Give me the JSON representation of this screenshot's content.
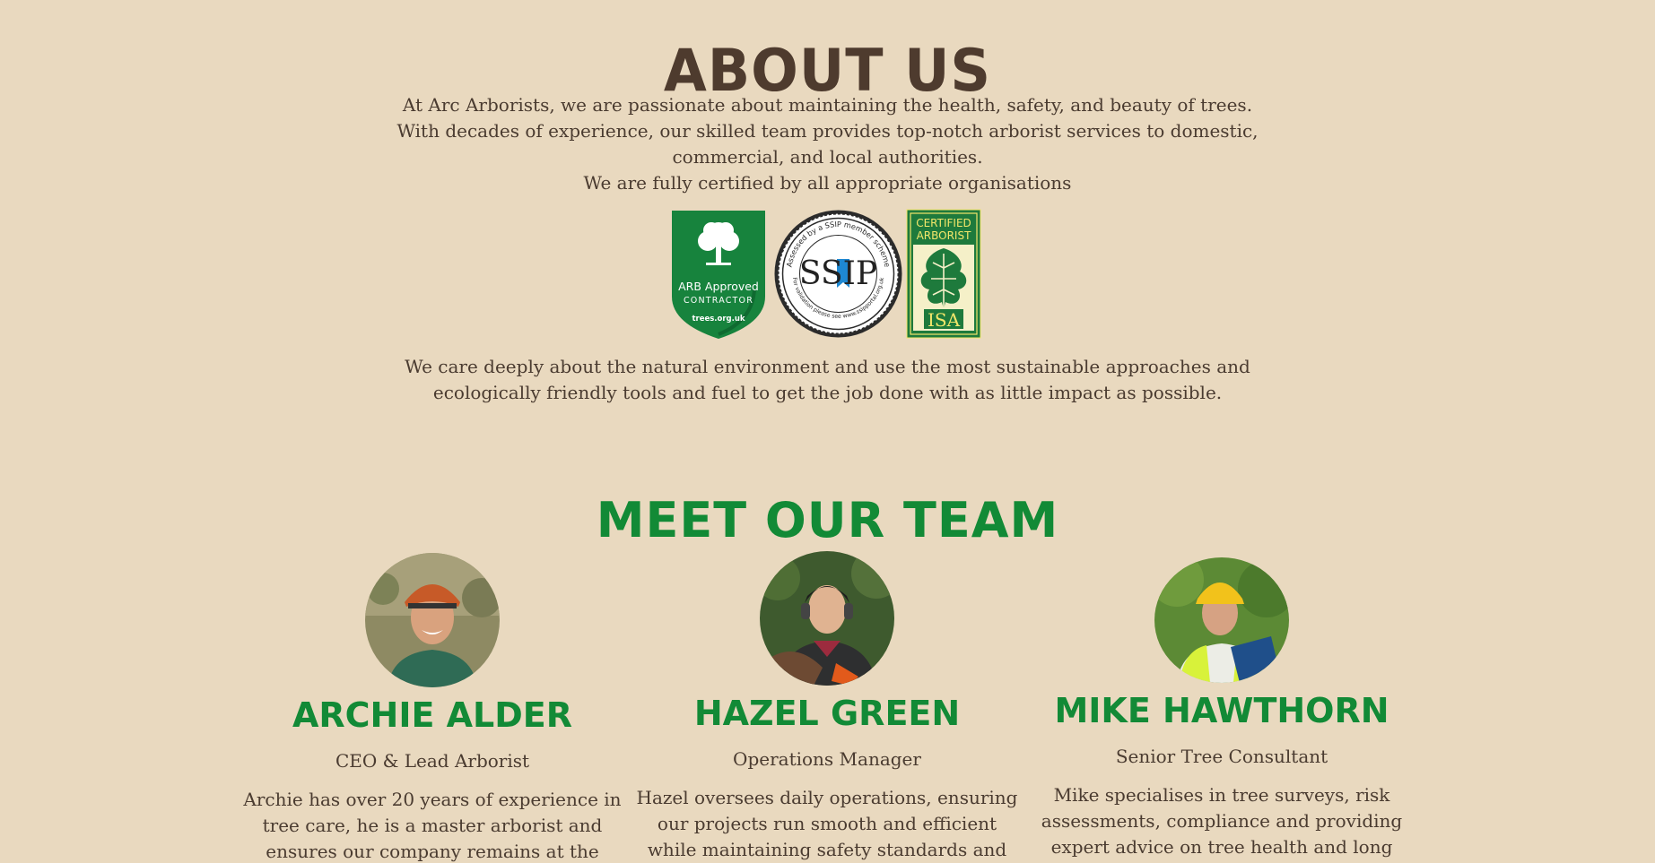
{
  "about": {
    "title": "ABOUT US",
    "intro_1": "At Arc Arborists, we are passionate about maintaining the health, safety, and beauty of trees. With decades of experience, our skilled team provides top-notch arborist services to domestic, commercial, and local authorities.",
    "intro_2": "We are fully certified by all appropriate organisations",
    "environment": "We care deeply about the natural environment and use the most sustainable approaches and ecologically friendly tools and fuel to get the job done with as little impact as possible."
  },
  "badges": {
    "arb": {
      "line1": "ARB Approved",
      "line2": "CONTRACTOR",
      "site": "trees.org.uk",
      "icon": "tree-icon",
      "color": "#17833D"
    },
    "ssip": {
      "text": "SSIP",
      "ring_top": "Assessed by a SSIP member scheme",
      "ring_bottom": "For validation please see www.ssipportal.org.uk",
      "icon": "ssip-seal-icon"
    },
    "isa": {
      "line1": "CERTIFIED",
      "line2": "ARBORIST",
      "mark": "ISA",
      "icon": "oak-leaf-icon",
      "color": "#1E7A3C"
    }
  },
  "team": {
    "title": "MEET OUR TEAM",
    "members": [
      {
        "name": "ARCHIE ALDER",
        "role": "CEO & Lead Arborist",
        "bio": "Archie has over 20 years of experience in tree care, he is a master arborist and ensures our company remains at the forefront of",
        "photo": "avatar-archie"
      },
      {
        "name": "HAZEL GREEN",
        "role": "Operations Manager",
        "bio": "Hazel oversees daily operations, ensuring our projects run smooth and efficient while maintaining safety standards and",
        "photo": "avatar-hazel"
      },
      {
        "name": "MIKE HAWTHORN",
        "role": "Senior Tree Consultant",
        "bio": "Mike specialises in tree surveys, risk assessments, compliance and providing expert advice on tree health and long term",
        "photo": "avatar-mike"
      }
    ]
  },
  "colors": {
    "background": "#E9D9BF",
    "heading_brown": "#4E3B2E",
    "heading_green": "#128A36",
    "body_text": "#4a3b30"
  }
}
